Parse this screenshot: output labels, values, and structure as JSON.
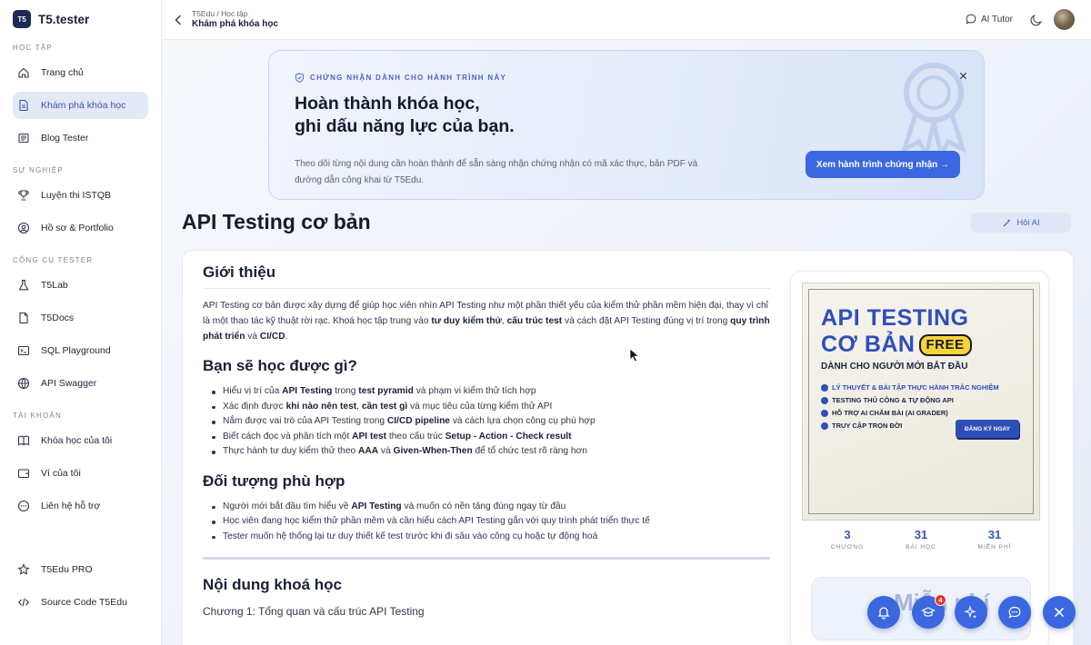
{
  "brand": {
    "logo": "T5",
    "name": "T5.tester"
  },
  "sidebar": {
    "sections": [
      {
        "label": "HỌC TẬP",
        "items": [
          {
            "label": "Trang chủ",
            "icon": "home-icon"
          },
          {
            "label": "Khám phá khóa học",
            "icon": "document-icon",
            "active": true
          },
          {
            "label": "Blog Tester",
            "icon": "newspaper-icon"
          }
        ]
      },
      {
        "label": "SỰ NGHIỆP",
        "items": [
          {
            "label": "Luyện thi ISTQB",
            "icon": "trophy-icon"
          },
          {
            "label": "Hồ sơ & Portfolio",
            "icon": "user-circle-icon"
          }
        ]
      },
      {
        "label": "CÔNG CỤ TESTER",
        "items": [
          {
            "label": "T5Lab",
            "icon": "flask-icon"
          },
          {
            "label": "T5Docs",
            "icon": "file-icon"
          },
          {
            "label": "SQL Playground",
            "icon": "terminal-icon"
          },
          {
            "label": "API Swagger",
            "icon": "globe-icon"
          }
        ]
      },
      {
        "label": "TÀI KHOẢN",
        "items": [
          {
            "label": "Khóa học của tôi",
            "icon": "book-icon"
          },
          {
            "label": "Ví của tôi",
            "icon": "wallet-icon"
          },
          {
            "label": "Liên hệ hỗ trợ",
            "icon": "chat-icon"
          }
        ]
      }
    ],
    "bottom": [
      {
        "label": "T5Edu PRO",
        "icon": "star-icon"
      },
      {
        "label": "Source Code T5Edu",
        "icon": "code-icon"
      }
    ]
  },
  "topbar": {
    "breadcrumb": "T5Edu / Học tập",
    "title": "Khám phá khóa học",
    "ai_tutor": "AI Tutor"
  },
  "banner": {
    "tag": "CHỨNG NHẬN DÀNH CHO HÀNH TRÌNH NÀY",
    "title_line1": "Hoàn thành khóa học,",
    "title_line2": "ghi dấu năng lực của bạn.",
    "desc": "Theo dõi từng nội dung cần hoàn thành để sẵn sàng nhận chứng nhận có mã xác thực, bản PDF và đường dẫn công khai từ T5Edu.",
    "button": "Xem hành trình chứng nhận →"
  },
  "course": {
    "title": "API Testing cơ bản",
    "ask_ai": "Hỏi AI"
  },
  "content": {
    "intro_heading": "Giới thiệu",
    "intro_parts": [
      "API Testing cơ bản được xây dựng để giúp học viên nhìn API Testing như một phần thiết yếu của kiểm thử phần mềm hiện đại, thay vì chỉ là một thao tác kỹ thuật rời rạc. Khoá học tập trung vào ",
      "tư duy kiểm thử",
      ", ",
      "cấu trúc test",
      " và cách đặt API Testing đúng vị trí trong ",
      "quy trình phát triển",
      " và ",
      "CI/CD",
      "."
    ],
    "learn_heading": "Bạn sẽ học được gì?",
    "learn_items": [
      [
        "Hiểu vị trí của ",
        "API Testing",
        " trong ",
        "test pyramid",
        " và phạm vi kiểm thử tích hợp"
      ],
      [
        "Xác định được ",
        "khi nào nên test",
        ", ",
        "cần test gì",
        " và mục tiêu của từng kiểm thử API"
      ],
      [
        "Nắm được vai trò của API Testing trong ",
        "CI/CD pipeline",
        " và cách lựa chọn công cụ phù hợp"
      ],
      [
        "Biết cách đọc và phân tích một ",
        "API test",
        " theo cấu trúc ",
        "Setup - Action - Check result",
        ""
      ],
      [
        "Thực hành tư duy kiểm thử theo ",
        "AAA",
        " và ",
        "Given-When-Then",
        " để tổ chức test rõ ràng hơn"
      ]
    ],
    "audience_heading": "Đối tượng phù hợp",
    "audience_items": [
      [
        "Người mới bắt đầu tìm hiểu về ",
        "API Testing",
        " và muốn có nền tảng đúng ngay từ đầu"
      ],
      [
        "Học viên đang học kiểm thử phần mềm và cần hiểu cách API Testing gắn với quy trình phát triển thực tế",
        "",
        ""
      ],
      [
        "Tester muốn hệ thống lại tư duy thiết kế test trước khi đi sâu vào công cụ hoặc tự động hoá",
        "",
        ""
      ]
    ],
    "syllabus_heading": "Nội dung khoá học",
    "chapter1": "Chương 1: Tổng quan và cấu trúc API Testing"
  },
  "poster": {
    "line1": "API TESTING",
    "line2": "CƠ BẢN",
    "free": "FREE",
    "subtitle": "DÀNH CHO NGƯỜI MỚI BẮT ĐẦU",
    "features": [
      {
        "text": "LÝ THUYẾT & BÀI TẬP THỰC HÀNH TRẮC NGHIỆM",
        "highlight": true
      },
      {
        "text": "TESTING THỦ CÔNG & TỰ ĐỘNG API",
        "highlight": false
      },
      {
        "text": "HỖ TRỢ AI CHẤM BÀI (AI GRADER)",
        "highlight": false
      },
      {
        "text": "TRUY CẬP TRỌN ĐỜI",
        "highlight": false
      }
    ],
    "register": "ĐĂNG KÝ NGAY"
  },
  "stats": [
    {
      "value": "3",
      "label": "CHƯƠNG"
    },
    {
      "value": "31",
      "label": "BÀI HỌC"
    },
    {
      "value": "31",
      "label": "MIỄN PHÍ"
    }
  ],
  "cta_text": "Miễn phí",
  "fabs": {
    "notification_badge": "4"
  },
  "colors": {
    "accent": "#3b67e0",
    "brand_dark": "#1d2a55",
    "active_bg": "#e4e9f6"
  }
}
